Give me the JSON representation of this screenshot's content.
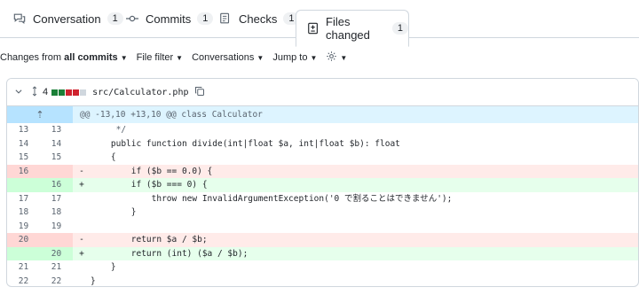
{
  "tabs": [
    {
      "label": "Conversation",
      "count": "1",
      "icon": "comment-discussion-icon"
    },
    {
      "label": "Commits",
      "count": "1",
      "icon": "git-commit-icon"
    },
    {
      "label": "Checks",
      "count": "1",
      "icon": "checklist-icon"
    },
    {
      "label": "Files changed",
      "count": "1",
      "icon": "file-diff-icon",
      "active": true
    }
  ],
  "toolbar": {
    "changes_prefix": "Changes from",
    "changes_value": "all commits",
    "file_filter": "File filter",
    "conversations": "Conversations",
    "jump_to": "Jump to"
  },
  "file": {
    "change_count": "4",
    "path": "src/Calculator.php"
  },
  "diff": {
    "hunk_header": "@@ -13,10 +13,10 @@ class Calculator",
    "lines": [
      {
        "old": "13",
        "new": "13",
        "sign": "",
        "type": "ctx",
        "code": "     */"
      },
      {
        "old": "14",
        "new": "14",
        "sign": "",
        "type": "ctx",
        "code": "    public function divide(int|float $a, int|float $b): float"
      },
      {
        "old": "15",
        "new": "15",
        "sign": "",
        "type": "ctx",
        "code": "    {"
      },
      {
        "old": "16",
        "new": "",
        "sign": "-",
        "type": "del",
        "code": "        if ($b == 0.0) {"
      },
      {
        "old": "",
        "new": "16",
        "sign": "+",
        "type": "add",
        "code": "        if ($b === 0) {"
      },
      {
        "old": "17",
        "new": "17",
        "sign": "",
        "type": "ctx",
        "code": "            throw new InvalidArgumentException('0 で割ることはできません');"
      },
      {
        "old": "18",
        "new": "18",
        "sign": "",
        "type": "ctx",
        "code": "        }"
      },
      {
        "old": "19",
        "new": "19",
        "sign": "",
        "type": "ctx",
        "code": ""
      },
      {
        "old": "20",
        "new": "",
        "sign": "-",
        "type": "del",
        "code": "        return $a / $b;"
      },
      {
        "old": "",
        "new": "20",
        "sign": "+",
        "type": "add",
        "code": "        return (int) ($a / $b);"
      },
      {
        "old": "21",
        "new": "21",
        "sign": "",
        "type": "ctx",
        "code": "    }"
      },
      {
        "old": "22",
        "new": "22",
        "sign": "",
        "type": "ctx",
        "code": "}"
      }
    ]
  },
  "colors": {
    "deletion_bg": "#ffebe9",
    "addition_bg": "#e6ffec",
    "hunk_bg": "#ddf4ff",
    "diffstat_added": "#1a7f37",
    "diffstat_removed": "#cf222e"
  }
}
